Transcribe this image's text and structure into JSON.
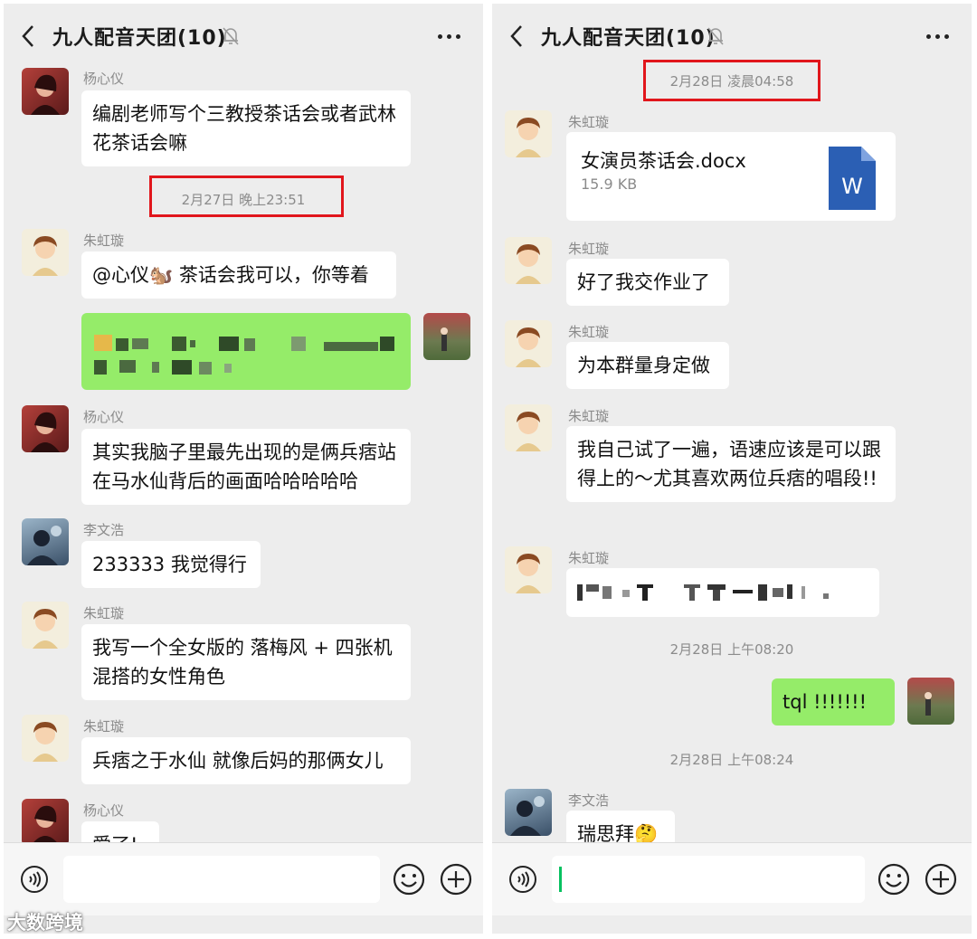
{
  "chat": {
    "title": "九人配音天团(10)"
  },
  "left": {
    "messages": [
      {
        "sender": "杨心仪",
        "text": "编剧老师写个三教授茶话会或者武林花茶话会嘛"
      },
      {
        "timestamp": "2月27日 晚上23:51"
      },
      {
        "sender": "朱虹璇",
        "text": "@心仪🐿️ 茶话会我可以，你等着"
      },
      {
        "sender": "杨心仪",
        "text": "其实我脑子里最先出现的是俩兵痞站在马水仙背后的画面哈哈哈哈哈"
      },
      {
        "sender": "李文浩",
        "text": "233333 我觉得行"
      },
      {
        "sender": "朱虹璇",
        "text": "我写一个全女版的 落梅风 + 四张机混搭的女性角色"
      },
      {
        "sender": "朱虹璇",
        "text": "兵痞之于水仙 就像后妈的那俩女儿"
      },
      {
        "sender": "杨心仪",
        "text": "爱了!"
      }
    ]
  },
  "right": {
    "messages": [
      {
        "timestamp": "2月28日 凌晨04:58"
      },
      {
        "sender": "朱虹璇",
        "file_name": "女演员茶话会.docx",
        "file_size": "15.9 KB",
        "file_icon_letter": "W"
      },
      {
        "sender": "朱虹璇",
        "text": "好了我交作业了"
      },
      {
        "sender": "朱虹璇",
        "text": "为本群量身定做"
      },
      {
        "sender": "朱虹璇",
        "text": "我自己试了一遍，语速应该是可以跟得上的～尤其喜欢两位兵痞的唱段!!"
      },
      {
        "sender": "朱虹璇"
      },
      {
        "timestamp": "2月28日 上午08:20"
      },
      {
        "text": "tql !!!!!!!"
      },
      {
        "timestamp": "2月28日 上午08:24"
      },
      {
        "sender": "李文浩",
        "text": "瑞思拜🤔"
      }
    ]
  },
  "watermark": "大数跨境",
  "colors": {
    "background": "#ededed",
    "own_bubble": "#95ec69",
    "other_bubble": "#ffffff",
    "highlight_box": "#e1161c",
    "word_blue": "#2b5fb4"
  },
  "icons": [
    "back-icon",
    "mute-bell-icon",
    "more-icon",
    "voice-icon",
    "emoji-icon",
    "plus-icon",
    "word-file-icon"
  ]
}
